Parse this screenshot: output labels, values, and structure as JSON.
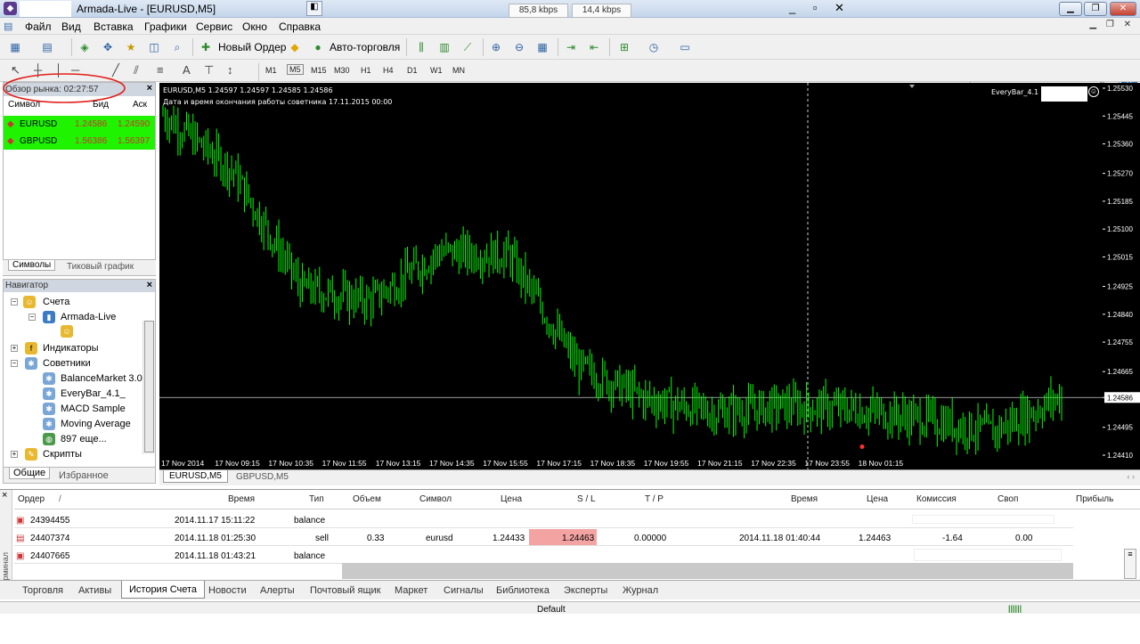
{
  "titlebar": {
    "title": "Armada-Live - [EURUSD,M5]",
    "speed_down": "85,8 kbps",
    "speed_up": "14,4 kbps"
  },
  "menu": [
    "Файл",
    "Вид",
    "Вставка",
    "Графики",
    "Сервис",
    "Окно",
    "Справка"
  ],
  "toolbar": {
    "new_order": "Новый Ордер",
    "auto_trading": "Авто-торговля"
  },
  "timeframes": [
    "M1",
    "M5",
    "M15",
    "M30",
    "H1",
    "H4",
    "D1",
    "W1",
    "MN"
  ],
  "drawing_tools": {
    "text": "A"
  },
  "market_watch": {
    "header": "Обзор рынка: 02:27:57",
    "columns": [
      "Символ",
      "Бид",
      "Аск"
    ],
    "rows": [
      {
        "symbol": "EURUSD",
        "bid": "1.24586",
        "ask": "1.24590"
      },
      {
        "symbol": "GBPUSD",
        "bid": "1.56386",
        "ask": "1.56397"
      }
    ],
    "tabs": [
      "Символы",
      "Тиковый график"
    ]
  },
  "navigator": {
    "header": "Навигатор",
    "accounts": "Счета",
    "account_name": "Armada-Live",
    "indicators": "Индикаторы",
    "experts": "Советники",
    "expert_items": [
      "BalanceMarket 3.0",
      "EveryBar_4.1_",
      "MACD Sample",
      "Moving Average",
      "897 еще..."
    ],
    "scripts": "Скрипты",
    "tabs": [
      "Общие",
      "Избранное"
    ]
  },
  "chart": {
    "info": "EURUSD,M5  1.24597 1.24597 1.24585 1.24586",
    "comment": "Дата и время окончания работы советника 17.11.2015 00:00",
    "ea_label": "EveryBar_4.1",
    "current_price": "1.24586",
    "y_ticks": [
      "1.25530",
      "1.25445",
      "1.25360",
      "1.25270",
      "1.25185",
      "1.25100",
      "1.25015",
      "1.24925",
      "1.24840",
      "1.24755",
      "1.24665",
      "1.24586",
      "1.24495",
      "1.24410"
    ],
    "x_ticks": [
      "17 Nov 2014",
      "17 Nov 09:15",
      "17 Nov 10:35",
      "17 Nov 11:55",
      "17 Nov 13:15",
      "17 Nov 14:35",
      "17 Nov 15:55",
      "17 Nov 17:15",
      "17 Nov 18:35",
      "17 Nov 19:55",
      "17 Nov 21:15",
      "17 Nov 22:35",
      "17 Nov 23:55",
      "18 Nov 01:15"
    ],
    "tabs": [
      "EURUSD,M5",
      "GBPUSD,M5"
    ],
    "colors": {
      "background": "#000000",
      "candles": "#00ff00",
      "grid": "#ffffff"
    }
  },
  "chart_data": {
    "type": "line",
    "title": "EURUSD,M5",
    "x": [
      "17 Nov 2014",
      "17 Nov 09:15",
      "17 Nov 10:35",
      "17 Nov 11:55",
      "17 Nov 13:15",
      "17 Nov 14:35",
      "17 Nov 15:55",
      "17 Nov 17:15",
      "17 Nov 18:35",
      "17 Nov 19:55",
      "17 Nov 21:15",
      "17 Nov 22:35",
      "17 Nov 23:55",
      "18 Nov 01:15"
    ],
    "series": [
      {
        "name": "EURUSD,M5",
        "values": [
          1.2545,
          1.2528,
          1.2492,
          1.2488,
          1.2503,
          1.2502,
          1.2468,
          1.2458,
          1.2454,
          1.2456,
          1.2455,
          1.2452,
          1.2448,
          1.2459
        ]
      }
    ],
    "ylim": [
      1.2441,
      1.2553
    ]
  },
  "terminal": {
    "side_label": "Терминал",
    "columns": [
      "Ордер",
      "Время",
      "Тип",
      "Объем",
      "Символ",
      "Цена",
      "S / L",
      "T / P",
      "Время",
      "Цена",
      "Комиссия",
      "Своп",
      "Прибыль"
    ],
    "rows": [
      {
        "order": "24394455",
        "time": "2014.11.17 15:11:22",
        "type": "balance",
        "volume": "",
        "symbol": "",
        "price": "",
        "sl": "",
        "tp": "",
        "close_time": "",
        "close_price": "",
        "commission": "",
        "swap": ""
      },
      {
        "order": "24407374",
        "time": "2014.11.18 01:25:30",
        "type": "sell",
        "volume": "0.33",
        "symbol": "eurusd",
        "price": "1.24433",
        "sl": "1.24463",
        "tp": "0.00000",
        "close_time": "2014.11.18 01:40:44",
        "close_price": "1.24463",
        "commission": "-1.64",
        "swap": "0.00"
      },
      {
        "order": "24407665",
        "time": "2014.11.18 01:43:21",
        "type": "balance",
        "volume": "",
        "symbol": "",
        "price": "",
        "sl": "",
        "tp": "",
        "close_time": "",
        "close_price": "",
        "commission": "",
        "swap": ""
      }
    ],
    "tabs": [
      "Торговля",
      "Активы",
      "История Счета",
      "Новости",
      "Алерты",
      "Почтовый ящик",
      "Маркет",
      "Сигналы",
      "Библиотека",
      "Эксперты",
      "Журнал"
    ]
  },
  "status": {
    "profile": "Default",
    "connection": "||||||"
  }
}
